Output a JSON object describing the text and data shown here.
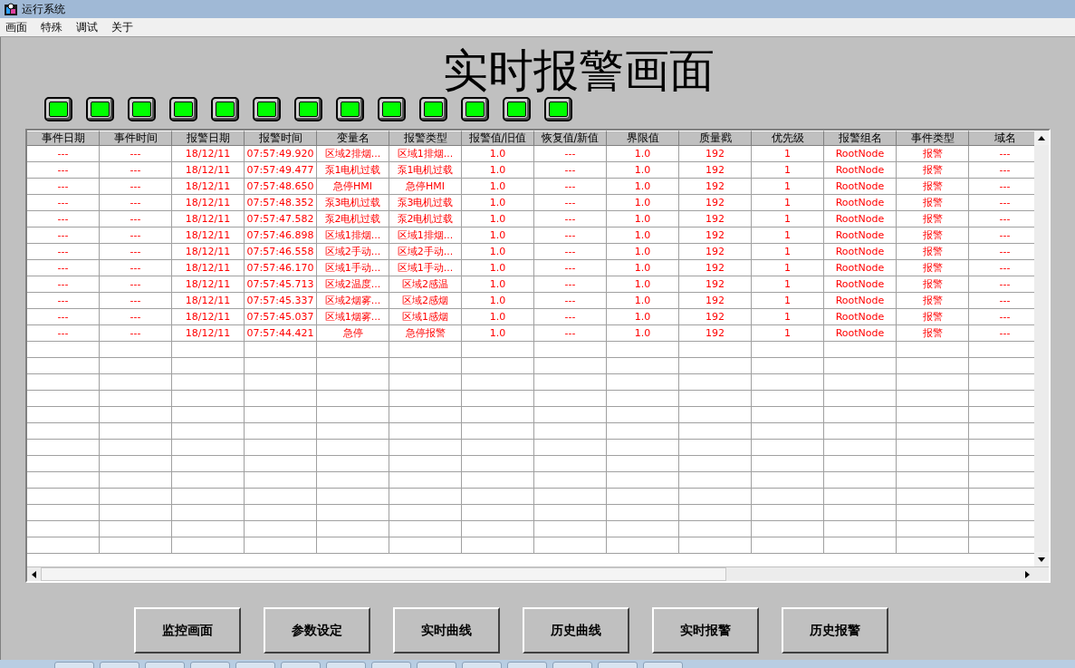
{
  "window": {
    "title": "运行系统"
  },
  "menu": [
    "画面",
    "特殊",
    "调试",
    "关于"
  ],
  "page_title": "实时报警画面",
  "lamps": [
    {
      "on": true
    },
    {
      "on": true
    },
    {
      "on": true
    },
    {
      "on": true
    },
    {
      "on": true
    },
    {
      "on": true
    },
    {
      "on": true
    },
    {
      "on": true
    },
    {
      "on": true
    },
    {
      "on": true
    },
    {
      "on": true
    },
    {
      "on": true
    },
    {
      "on": true
    }
  ],
  "table": {
    "columns": [
      "事件日期",
      "事件时间",
      "报警日期",
      "报警时间",
      "变量名",
      "报警类型",
      "报警值/旧值",
      "恢复值/新值",
      "界限值",
      "质量戳",
      "优先级",
      "报警组名",
      "事件类型",
      "域名"
    ],
    "rows": [
      [
        "---",
        "---",
        "18/12/11",
        "07:57:49.920",
        "区域2排烟...",
        "区域1排烟...",
        "1.0",
        "---",
        "1.0",
        "192",
        "1",
        "RootNode",
        "报警",
        "---"
      ],
      [
        "---",
        "---",
        "18/12/11",
        "07:57:49.477",
        "泵1电机过载",
        "泵1电机过载",
        "1.0",
        "---",
        "1.0",
        "192",
        "1",
        "RootNode",
        "报警",
        "---"
      ],
      [
        "---",
        "---",
        "18/12/11",
        "07:57:48.650",
        "急停HMI",
        "急停HMI",
        "1.0",
        "---",
        "1.0",
        "192",
        "1",
        "RootNode",
        "报警",
        "---"
      ],
      [
        "---",
        "---",
        "18/12/11",
        "07:57:48.352",
        "泵3电机过载",
        "泵3电机过载",
        "1.0",
        "---",
        "1.0",
        "192",
        "1",
        "RootNode",
        "报警",
        "---"
      ],
      [
        "---",
        "---",
        "18/12/11",
        "07:57:47.582",
        "泵2电机过载",
        "泵2电机过载",
        "1.0",
        "---",
        "1.0",
        "192",
        "1",
        "RootNode",
        "报警",
        "---"
      ],
      [
        "---",
        "---",
        "18/12/11",
        "07:57:46.898",
        "区域1排烟...",
        "区域1排烟...",
        "1.0",
        "---",
        "1.0",
        "192",
        "1",
        "RootNode",
        "报警",
        "---"
      ],
      [
        "---",
        "---",
        "18/12/11",
        "07:57:46.558",
        "区域2手动...",
        "区域2手动...",
        "1.0",
        "---",
        "1.0",
        "192",
        "1",
        "RootNode",
        "报警",
        "---"
      ],
      [
        "---",
        "---",
        "18/12/11",
        "07:57:46.170",
        "区域1手动...",
        "区域1手动...",
        "1.0",
        "---",
        "1.0",
        "192",
        "1",
        "RootNode",
        "报警",
        "---"
      ],
      [
        "---",
        "---",
        "18/12/11",
        "07:57:45.713",
        "区域2温度...",
        "区域2感温",
        "1.0",
        "---",
        "1.0",
        "192",
        "1",
        "RootNode",
        "报警",
        "---"
      ],
      [
        "---",
        "---",
        "18/12/11",
        "07:57:45.337",
        "区域2烟雾...",
        "区域2感烟",
        "1.0",
        "---",
        "1.0",
        "192",
        "1",
        "RootNode",
        "报警",
        "---"
      ],
      [
        "---",
        "---",
        "18/12/11",
        "07:57:45.037",
        "区域1烟雾...",
        "区域1感烟",
        "1.0",
        "---",
        "1.0",
        "192",
        "1",
        "RootNode",
        "报警",
        "---"
      ],
      [
        "---",
        "---",
        "18/12/11",
        "07:57:44.421",
        "急停",
        "急停报警",
        "1.0",
        "---",
        "1.0",
        "192",
        "1",
        "RootNode",
        "报警",
        "---"
      ]
    ]
  },
  "buttons": [
    "监控画面",
    "参数设定",
    "实时曲线",
    "历史曲线",
    "实时报警",
    "历史报警"
  ]
}
